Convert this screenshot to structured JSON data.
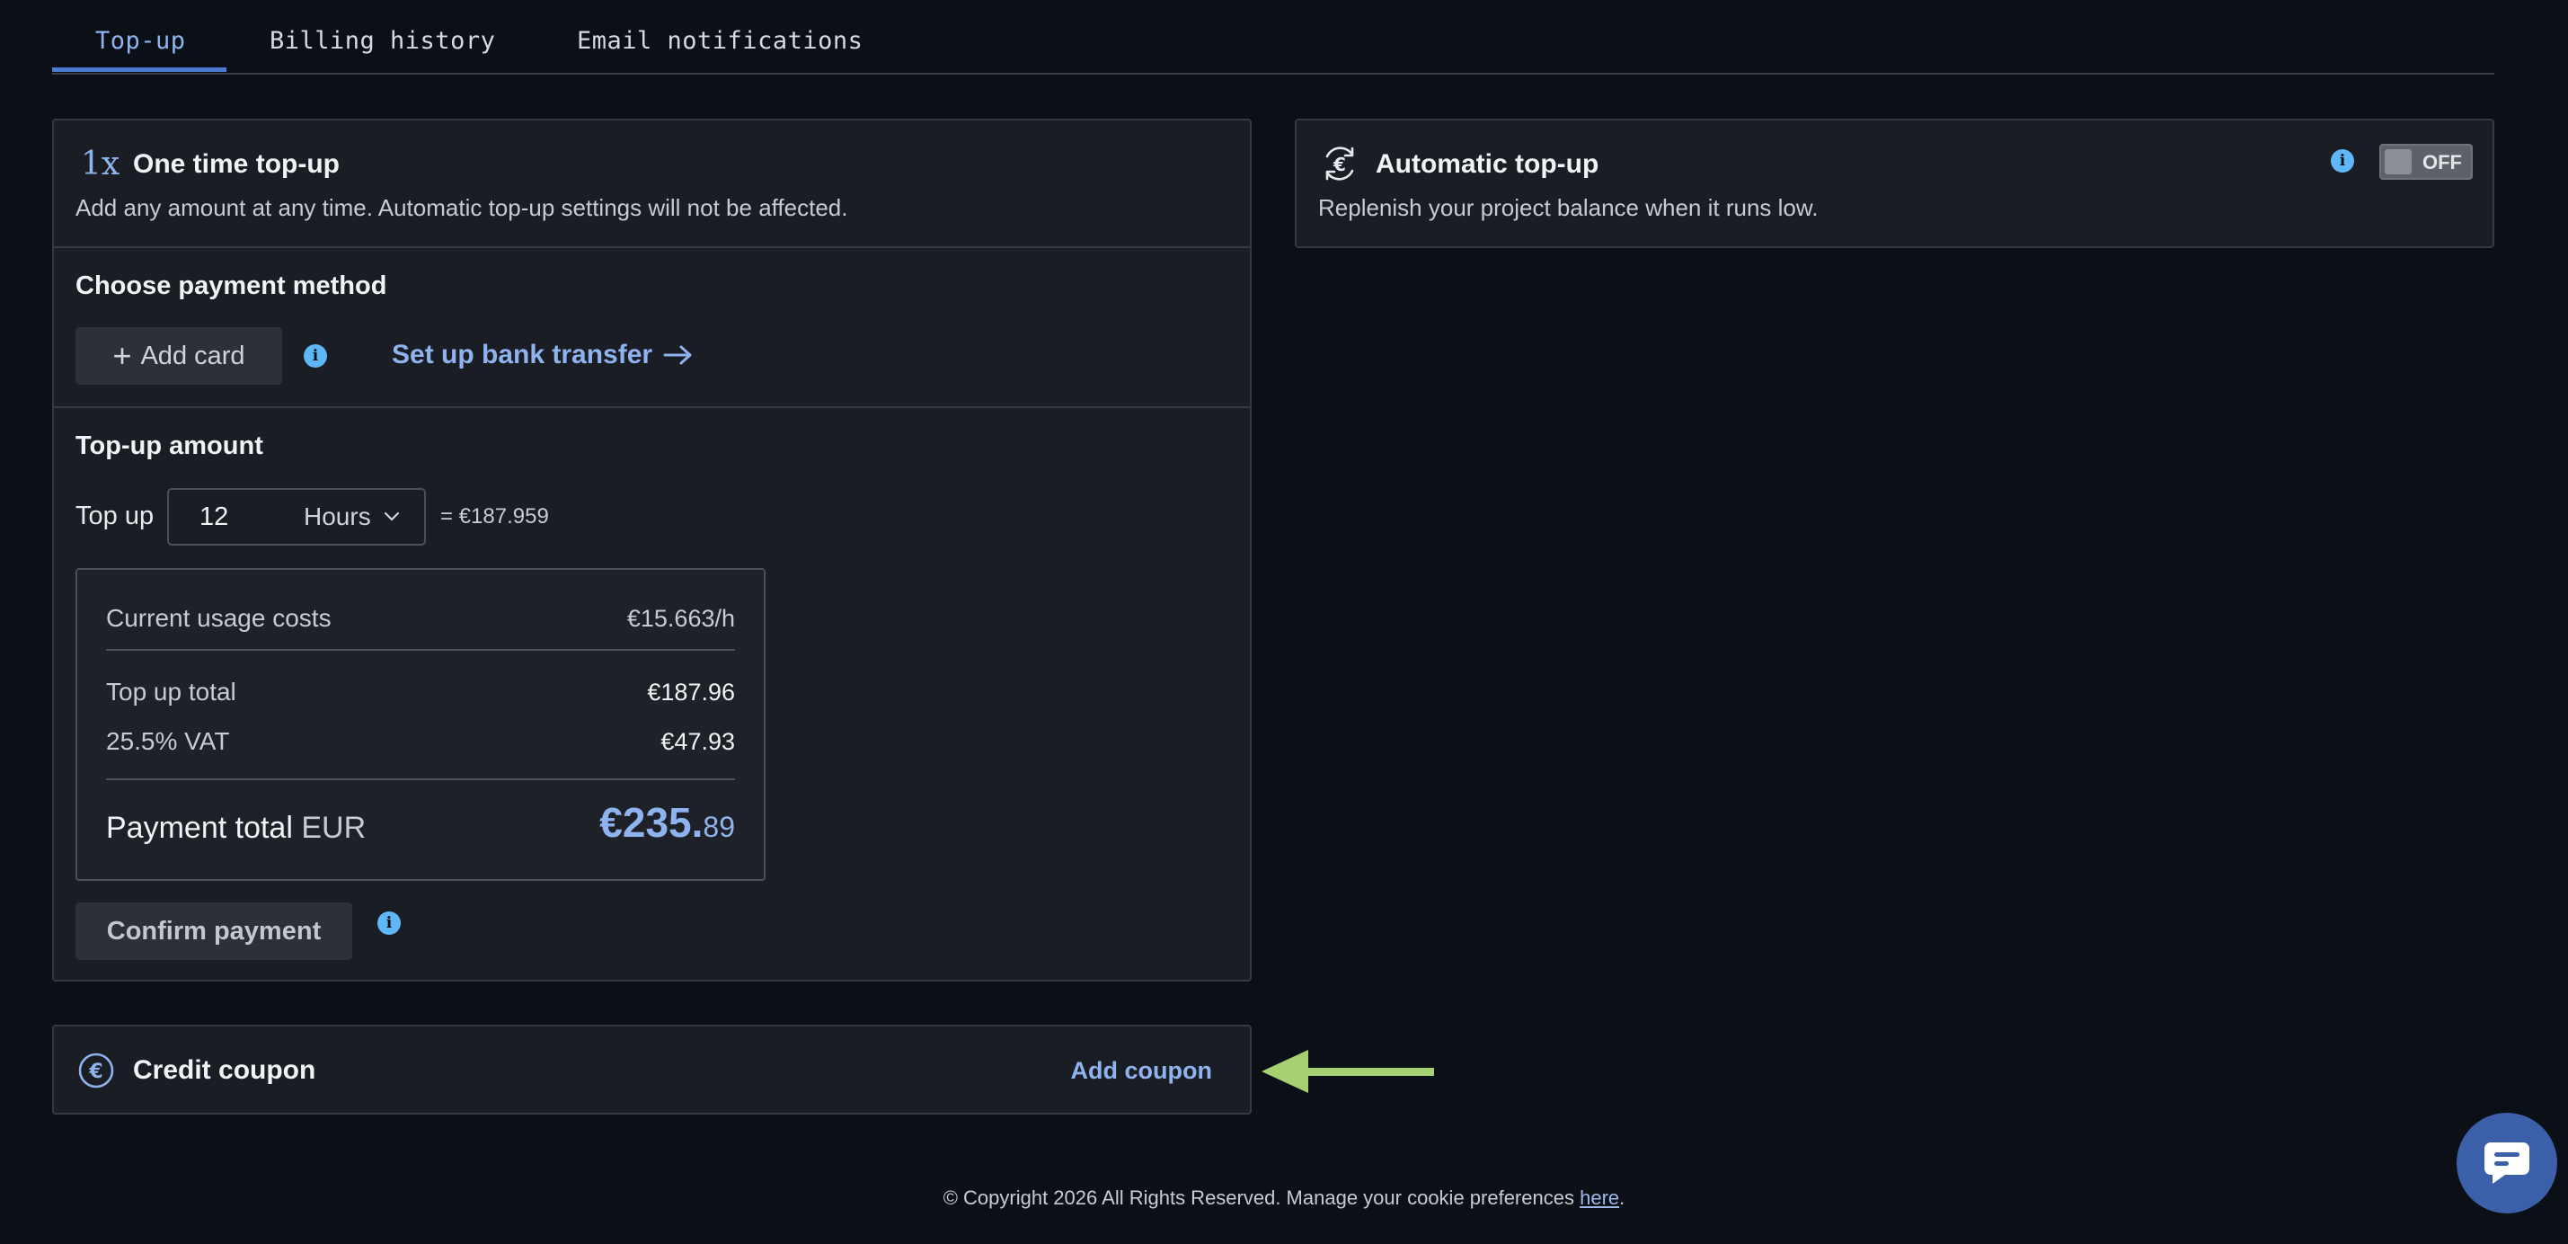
{
  "tabs": [
    {
      "label": "Top-up",
      "active": true
    },
    {
      "label": "Billing history",
      "active": false
    },
    {
      "label": "Email notifications",
      "active": false
    }
  ],
  "one_time": {
    "icon": "one-x-icon",
    "icon_glyph": "1x",
    "title": "One time top-up",
    "subtitle": "Add any amount at any time. Automatic top-up settings will not be affected."
  },
  "payment_method": {
    "title": "Choose payment method",
    "add_card_label": "Add card",
    "bank_transfer_label": "Set up bank transfer"
  },
  "topup_amount": {
    "title": "Top-up amount",
    "prefix": "Top up",
    "value": "12",
    "unit": "Hours",
    "equals": "= €187.959"
  },
  "summary": {
    "current_usage_label": "Current usage costs",
    "current_usage_value": "€15.663/h",
    "topup_total_label": "Top up total",
    "topup_total_value": "€187.96",
    "vat_label": "25.5% VAT",
    "vat_value": "€47.93",
    "payment_total_label": "Payment total",
    "payment_total_currency": "EUR",
    "payment_total_major": "€235.",
    "payment_total_minor": "89"
  },
  "confirm_label": "Confirm payment",
  "automatic": {
    "title": "Automatic top-up",
    "subtitle": "Replenish your project balance when it runs low.",
    "toggle_label": "OFF",
    "toggle_on": false
  },
  "coupon": {
    "title": "Credit coupon",
    "add_label": "Add coupon"
  },
  "footer": {
    "text": "© Copyright 2026 All Rights Reserved. Manage your cookie preferences ",
    "link": "here",
    "end": "."
  },
  "colors": {
    "accent": "#8fb3ef",
    "arrow": "#a6d173",
    "info": "#5fb8f5",
    "background": "#0b1017",
    "card": "#1a1d23"
  }
}
